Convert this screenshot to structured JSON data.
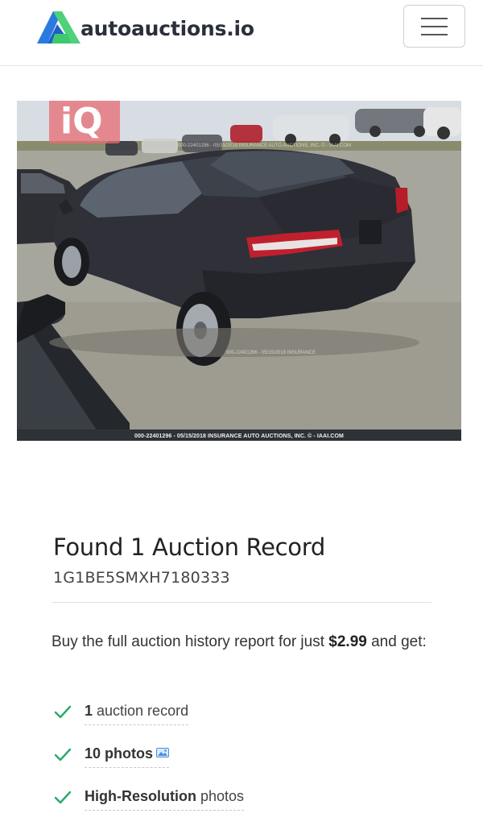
{
  "header": {
    "logo_text": "autoauctions.io",
    "logo_icon": "autoauctions-logo-icon",
    "menu_icon": "hamburger-menu-icon"
  },
  "photo": {
    "badge_text": "iQ",
    "caption": "000-22401296 - 05/15/2018 INSURANCE AUTO AUCTIONS, INC. © - IAAI.COM",
    "watermark_top": "000-22401296 - 05/15/2018 INSURANCE AUTO AUCTIONS, INC. © - IAAI.COM",
    "watermark_mid": "000-22401296 - 05/15/2018 INSURANCE"
  },
  "record": {
    "title": "Found 1 Auction Record",
    "vin": "1G1BE5SMXH7180333"
  },
  "offer": {
    "text_before": "Buy the full auction history report for just ",
    "price": "$2.99",
    "text_after": " and get:"
  },
  "features": [
    {
      "bold": "1",
      "rest": " auction record",
      "icon": "check-icon"
    },
    {
      "bold": "10 photos",
      "rest": "",
      "icon": "check-icon",
      "trail_icon": "image-icon"
    },
    {
      "bold": "High-Resolution",
      "rest": " photos",
      "icon": "check-icon"
    }
  ],
  "colors": {
    "logo_blue": "#2a6fdb",
    "logo_green": "#3ec96e",
    "check_green": "#2aa86a"
  }
}
